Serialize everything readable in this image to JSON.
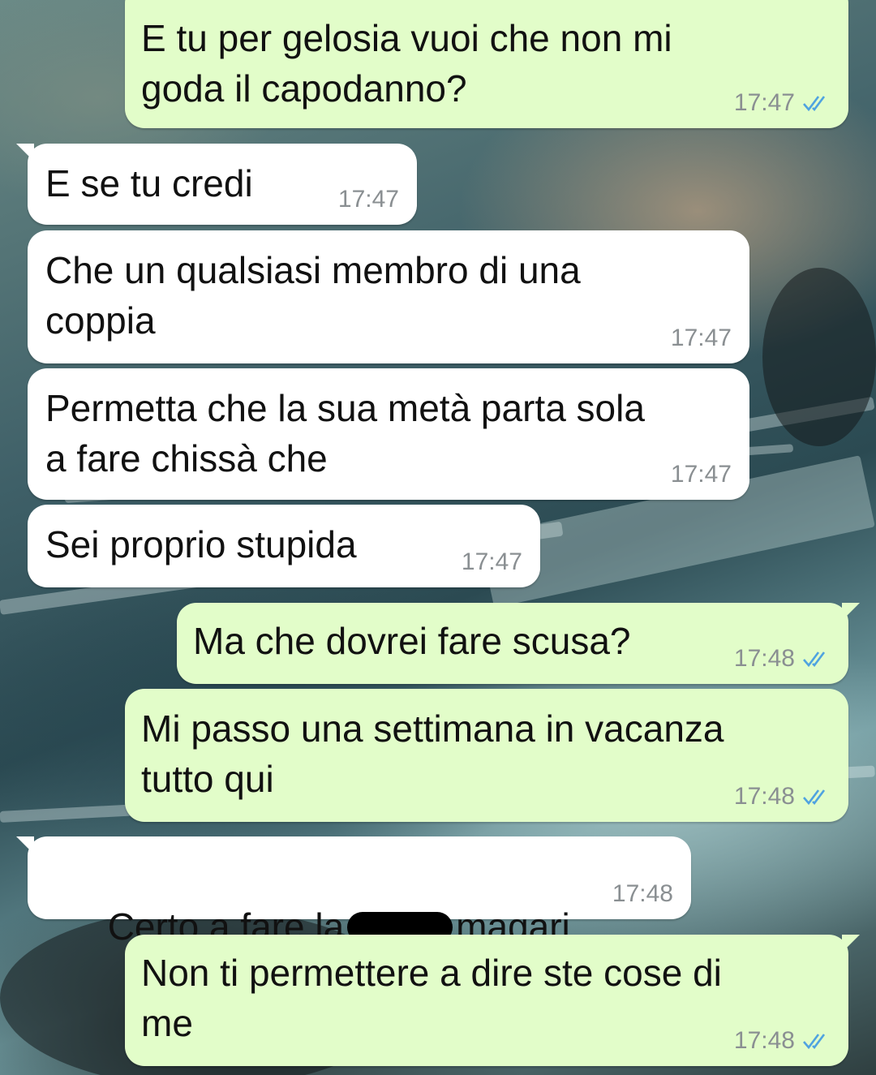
{
  "theme": {
    "incoming_bubble": "#ffffff",
    "outgoing_bubble": "#e2fdc9",
    "read_tick_color": "#4fa3e0",
    "timestamp_color": "#8a8f92"
  },
  "messages": [
    {
      "direction": "outgoing",
      "text": "E tu per gelosia vuoi che non mi\ngoda il capodanno?",
      "time": "17:47",
      "status": "read-double-check-icon"
    },
    {
      "direction": "incoming",
      "text": "E se tu credi",
      "time": "17:47"
    },
    {
      "direction": "incoming",
      "text": "Che un qualsiasi membro di una\ncoppia",
      "time": "17:47"
    },
    {
      "direction": "incoming",
      "text": "Permetta che la sua metà parta sola\na fare chissà che",
      "time": "17:47"
    },
    {
      "direction": "incoming",
      "text": "Sei proprio stupida",
      "time": "17:47"
    },
    {
      "direction": "outgoing",
      "text": "Ma che dovrei fare scusa?",
      "time": "17:48",
      "status": "read-double-check-icon"
    },
    {
      "direction": "outgoing",
      "text": "Mi passo una settimana in vacanza\ntutto qui",
      "time": "17:48",
      "status": "read-double-check-icon"
    },
    {
      "direction": "incoming",
      "text_before": "Certo a fare la",
      "text_after": "magari",
      "time": "17:48",
      "redacted": true
    },
    {
      "direction": "outgoing",
      "text": "Non ti permettere a dire ste cose di\nme",
      "time": "17:48",
      "status": "read-double-check-icon"
    }
  ]
}
